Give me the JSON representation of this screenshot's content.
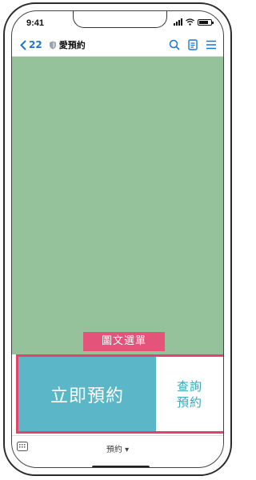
{
  "status_bar": {
    "time": "9:41"
  },
  "nav_bar": {
    "back_count": "22",
    "title": "愛預約"
  },
  "rich_menu": {
    "badge_label": "圖文選單",
    "primary_label": "立即預約",
    "secondary_label_line1": "查詢",
    "secondary_label_line2": "預約"
  },
  "bottom_bar": {
    "label": "預約 ▾"
  },
  "colors": {
    "content_bg": "#95c29b",
    "primary_button": "#5bb7c7",
    "accent_pink": "#e0446e",
    "link_blue": "#1b74d8"
  },
  "icons": [
    "chevron-left-icon",
    "shield-icon",
    "search-icon",
    "notes-icon",
    "menu-icon",
    "keyboard-icon"
  ]
}
